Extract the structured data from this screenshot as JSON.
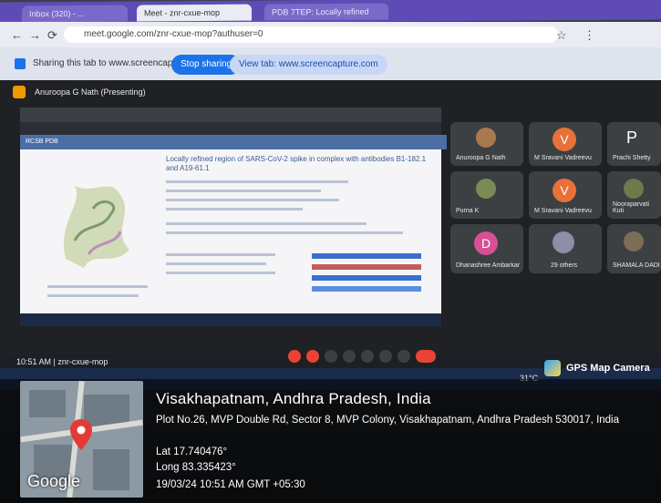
{
  "browser": {
    "tabs": [
      "Inbox (320) - ...",
      "Meet - znr-cxue-mop",
      "PDB 7TEP: Locally refined"
    ],
    "url": "meet.google.com/znr-cxue-mop?authuser=0"
  },
  "share_bar": {
    "text": "Sharing this tab to www.screencapture.com",
    "stop_label": "Stop sharing",
    "view_label": "View tab: www.screencapture.com"
  },
  "meet": {
    "presenter": "Anuroopa G Nath (Presenting)",
    "pdb_title": "Locally refined region of SARS-CoV-2 spike in complex with antibodies B1-182.1 and A19-61.1",
    "tiles": [
      {
        "name": "Anuroopa G Nath",
        "initial": ""
      },
      {
        "name": "M Sravani Vadreevu",
        "initial": "V"
      },
      {
        "name": "Prachi Shetty",
        "initial": "P"
      },
      {
        "name": "Purna K",
        "initial": ""
      },
      {
        "name": "M Sravani Vadreevu",
        "initial": "V"
      },
      {
        "name": "Nooraparvati Kuti",
        "initial": ""
      },
      {
        "name": "Dhanashree Ambarkar",
        "initial": "D"
      },
      {
        "name": "29 others",
        "initial": ""
      },
      {
        "name": "SHAMALA DADI",
        "initial": ""
      }
    ],
    "meeting_code": "10:51 AM | znr-cxue-mop",
    "weather": "31°C"
  },
  "gps": {
    "badge": "GPS Map Camera",
    "city": "Visakhapatnam, Andhra Pradesh, India",
    "address": "Plot No.26, MVP Double Rd, Sector 8, MVP Colony, Visakhapatnam, Andhra Pradesh 530017, India",
    "lat": "Lat 17.740476°",
    "long": "Long 83.335423°",
    "datetime": "19/03/24 10:51 AM GMT +05:30",
    "map_logo": "Google"
  },
  "colors": {
    "meet_bg": "#202124",
    "share_button": "#1a73e8",
    "pin": "#e53935",
    "avatar_orange": "#e8713a",
    "avatar_pink": "#d64f97"
  }
}
